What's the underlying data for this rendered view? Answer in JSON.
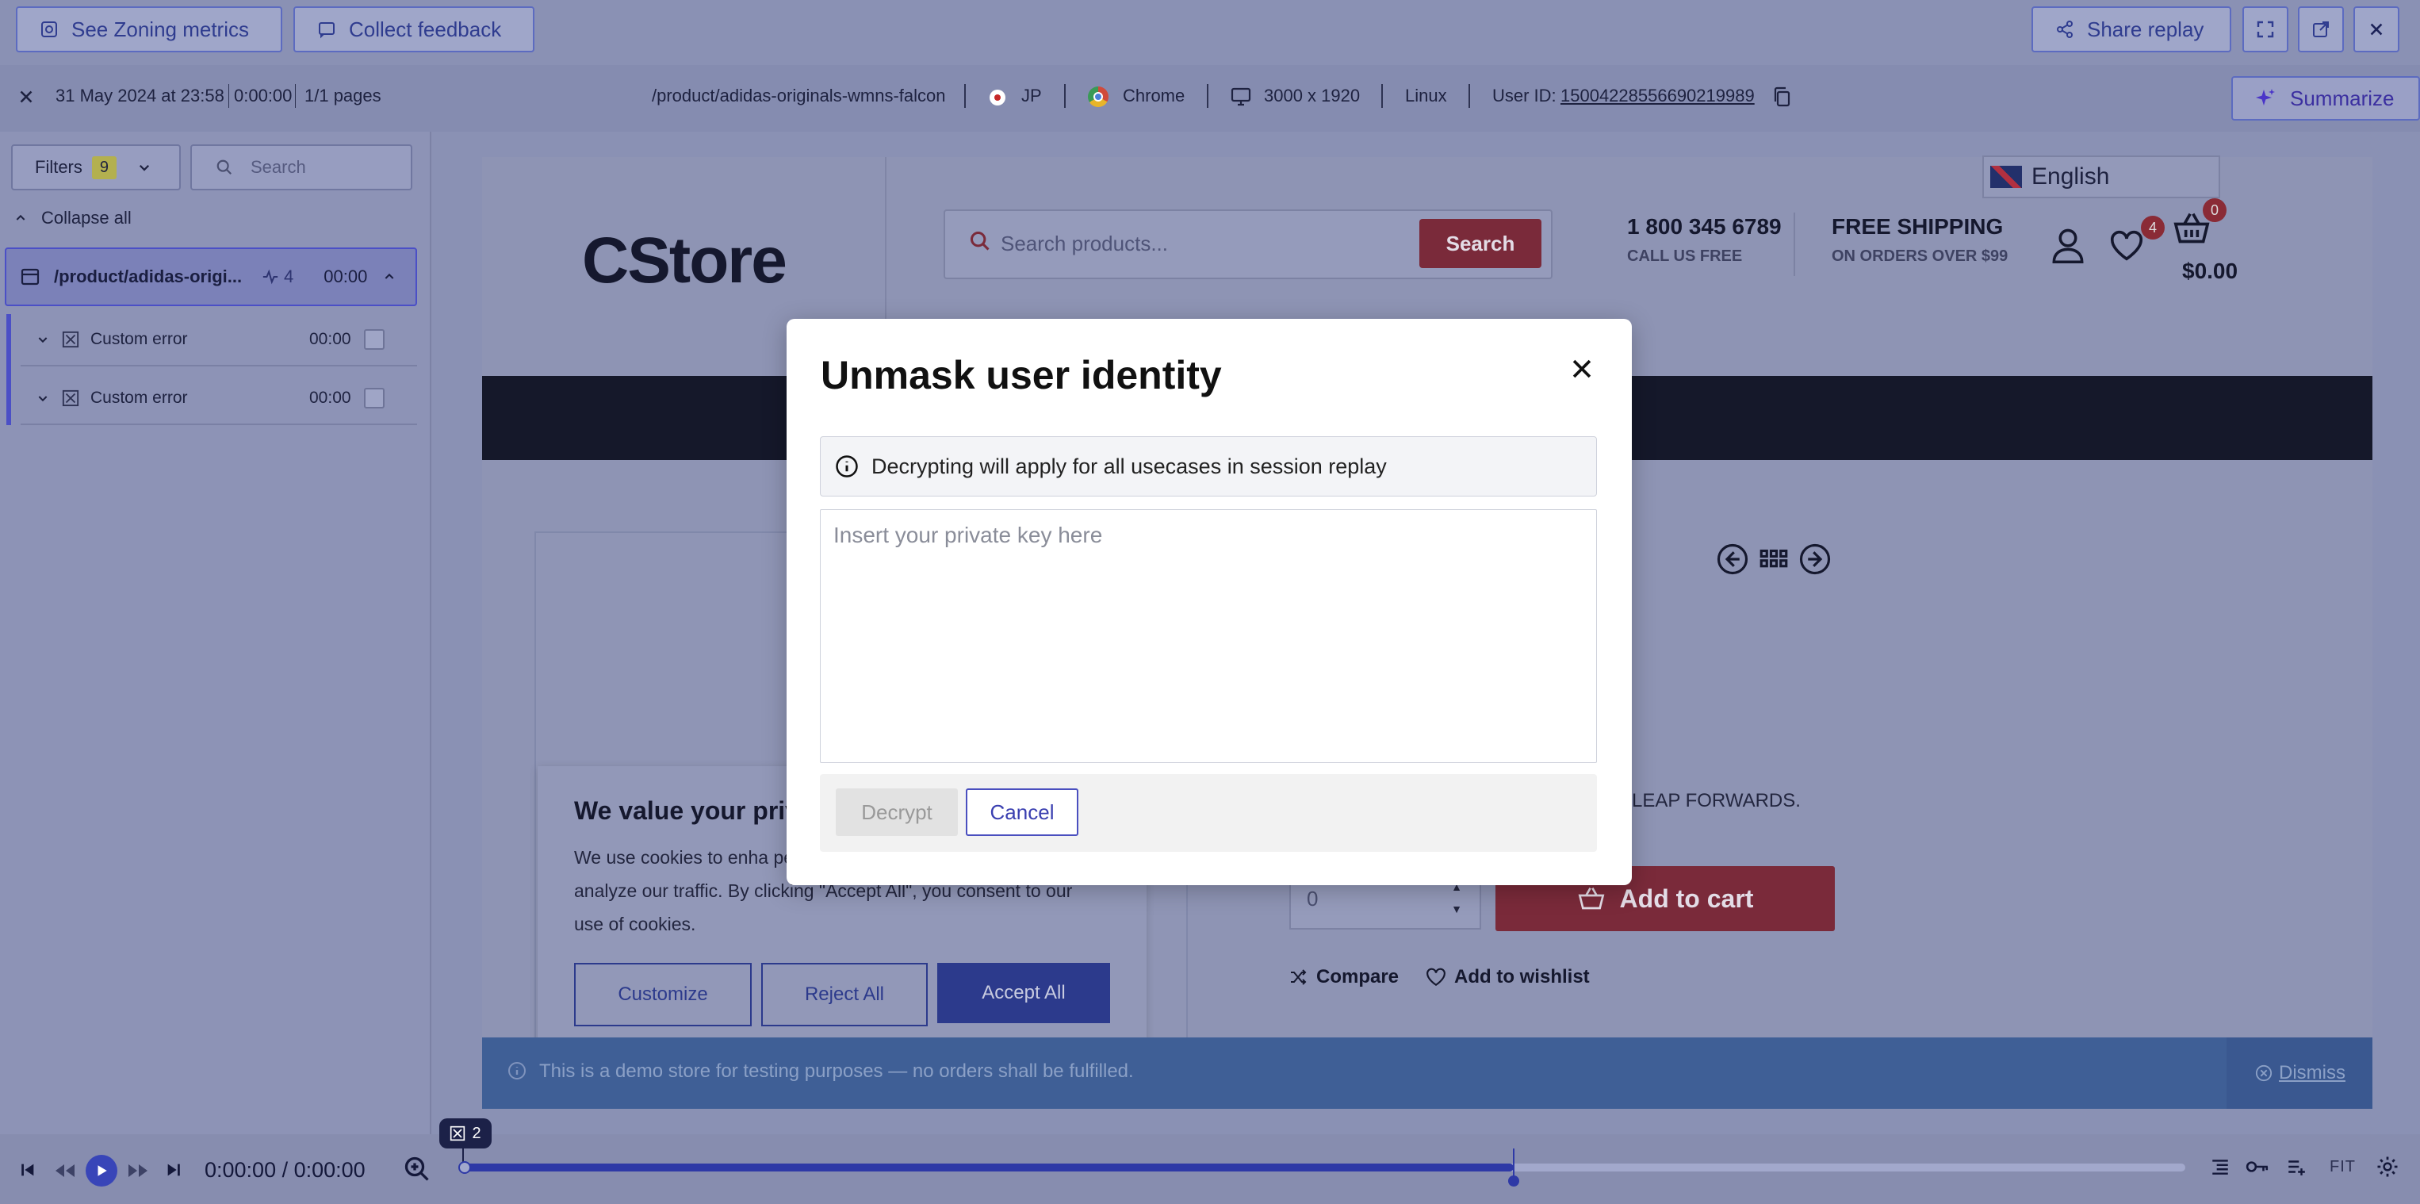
{
  "toolbar": {
    "zoning_label": "See Zoning metrics",
    "feedback_label": "Collect feedback",
    "share_label": "Share replay"
  },
  "session": {
    "datetime": "31 May 2024 at 23:58",
    "duration": "0:00:00",
    "pages": "1/1 pages",
    "url": "/product/adidas-originals-wmns-falcon",
    "country": "JP",
    "browser": "Chrome",
    "resolution": "3000 x 1920",
    "os": "Linux",
    "user_id_label": "User ID:",
    "user_id": "15004228556690219989",
    "summarize_label": "Summarize"
  },
  "sidebar": {
    "filters_label": "Filters",
    "filters_count": "9",
    "search_placeholder": "Search",
    "collapse_label": "Collapse all",
    "page_item": {
      "label": "/product/adidas-origi...",
      "count": "4",
      "time": "00:00"
    },
    "events": [
      {
        "label": "Custom error",
        "time": "00:00"
      },
      {
        "label": "Custom error",
        "time": "00:00"
      }
    ]
  },
  "store": {
    "language": "English",
    "logo": "CStore",
    "search_placeholder": "Search products...",
    "search_button": "Search",
    "phone": "1 800 345 6789",
    "phone_sub": "CALL US FREE",
    "shipping": "FREE SHIPPING",
    "shipping_sub": "ON ORDERS OVER $99",
    "wishlist_count": "4",
    "cart_count": "0",
    "cart_total": "$0.00",
    "tagline_fragment": "C LEAP FORWARDS.",
    "qty_value": "0",
    "add_to_cart": "Add to cart",
    "compare": "Compare",
    "add_wishlist": "Add to wishlist",
    "demo_notice": "This is a demo store for testing purposes — no orders shall be fulfilled.",
    "dismiss": "Dismiss"
  },
  "cookie": {
    "title": "We value your priv",
    "body": "We use cookies to enha personalized ads or content, and analyze our traffic. By clicking \"Accept All\", you consent to our use of cookies.",
    "customize": "Customize",
    "reject": "Reject All",
    "accept": "Accept All"
  },
  "modal": {
    "title": "Unmask user identity",
    "info": "Decrypting will apply for all usecases in session replay",
    "key_placeholder": "Insert your private key here",
    "decrypt_label": "Decrypt",
    "cancel_label": "Cancel"
  },
  "player": {
    "time": "0:00:00 / 0:00:00",
    "marker_count": "2",
    "progress": 0.61,
    "fit_label": "FIT"
  },
  "colors": {
    "accent": "#4f46e5",
    "store_red": "#c0282d",
    "overlay": "rgba(40,48,100,0.45)"
  }
}
